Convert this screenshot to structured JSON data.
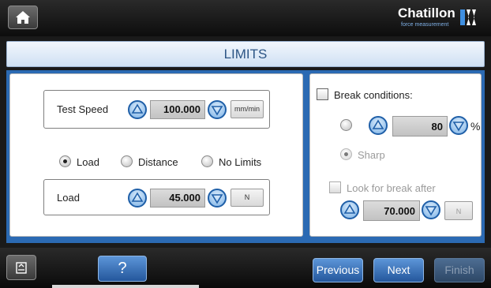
{
  "header": {
    "home_icon": "home-icon",
    "brand": "Chatillon",
    "tagline": "force measurement"
  },
  "title": "LIMITS",
  "test_speed": {
    "label": "Test Speed",
    "value": "100.000",
    "unit": "mm/min"
  },
  "limit_mode": {
    "options": [
      "Load",
      "Distance",
      "No Limits"
    ],
    "selected": "Load"
  },
  "load": {
    "label": "Load",
    "value": "45.000",
    "unit": "N"
  },
  "break": {
    "label": "Break conditions:",
    "checked": false,
    "percent_value": "80",
    "percent_unit": "%",
    "sharp_label": "Sharp",
    "look_label": "Look for break after",
    "look_checked": false,
    "look_value": "70.000",
    "look_unit": "N"
  },
  "footer": {
    "help_label": "?",
    "previous_label": "Previous",
    "next_label": "Next",
    "finish_label": "Finish"
  },
  "colors": {
    "accent_blue": "#2b6ab3",
    "title_text": "#2c5585"
  }
}
